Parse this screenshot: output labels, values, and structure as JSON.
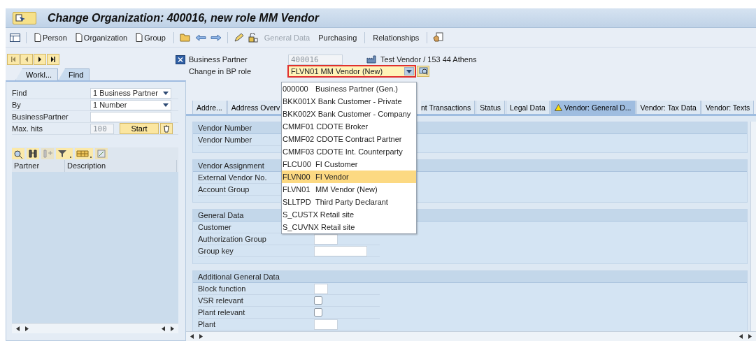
{
  "window": {
    "title": "Change Organization: 400016, new role MM Vendor"
  },
  "toolbar": {
    "create": [
      "Person",
      "Organization",
      "Group"
    ],
    "actions": [
      {
        "label": "General Data",
        "disabled": true
      },
      {
        "label": "Purchasing",
        "disabled": false
      },
      {
        "label": "Relationships",
        "disabled": false
      }
    ]
  },
  "locator": {
    "tabs": [
      {
        "label": "Workl...",
        "selected": false
      },
      {
        "label": "Find",
        "selected": true
      }
    ],
    "find": [
      {
        "label": "Find",
        "kind": "select",
        "value": "1 Business Partner"
      },
      {
        "label": "By",
        "kind": "select",
        "value": "1 Number"
      },
      {
        "label": "BusinessPartner",
        "kind": "input"
      }
    ],
    "max_hits": {
      "label": "Max. hits",
      "value": "100"
    },
    "start_button": "Start",
    "columns": [
      "Partner",
      "Description"
    ]
  },
  "header": {
    "business_partner": {
      "label": "Business Partner",
      "value": "400016",
      "description": "Test Vendor / 153 44 Athens"
    },
    "role": {
      "label": "Change in BP role",
      "value": "FLVN01 MM Vendor (New)",
      "expanded": true,
      "options": [
        {
          "code": "000000",
          "text": "Business Partner (Gen.)",
          "selected": false
        },
        {
          "code": "BKK001X",
          "text": "Bank Customer - Private",
          "selected": false
        },
        {
          "code": "BKK002X",
          "text": "Bank Customer - Company",
          "selected": false
        },
        {
          "code": "CMMF01",
          "text": "CDOTE Broker",
          "selected": false
        },
        {
          "code": "CMMF02",
          "text": "CDOTE Contract Partner",
          "selected": false
        },
        {
          "code": "CMMF03",
          "text": "CDOTE Int. Counterparty",
          "selected": false
        },
        {
          "code": "FLCU00",
          "text": "FI Customer",
          "selected": false
        },
        {
          "code": "FLVN00",
          "text": "FI Vendor",
          "selected": true
        },
        {
          "code": "FLVN01",
          "text": "MM Vendor (New)",
          "selected": false
        },
        {
          "code": "SLLTPD",
          "text": "Third Party Declarant",
          "selected": false
        },
        {
          "code": "S_CUSTX",
          "text": "Retail site",
          "selected": false
        },
        {
          "code": "S_CUVNX",
          "text": "Retail site",
          "selected": false
        }
      ]
    }
  },
  "tabs": [
    {
      "label": "Addre...",
      "selected": false,
      "warning": false,
      "kind": "normal"
    },
    {
      "label": "Address Overv",
      "selected": false,
      "warning": false,
      "kind": "cut_right"
    },
    {
      "label": "nt Transactions",
      "selected": false,
      "warning": false,
      "kind": "cut_left"
    },
    {
      "label": "Status",
      "selected": false,
      "warning": false,
      "kind": "normal"
    },
    {
      "label": "Legal Data",
      "selected": false,
      "warning": false,
      "kind": "normal"
    },
    {
      "label": "Vendor: General D...",
      "selected": true,
      "warning": true,
      "kind": "normal"
    },
    {
      "label": "Vendor: Tax Data",
      "selected": false,
      "warning": false,
      "kind": "normal"
    },
    {
      "label": "Vendor: Texts",
      "selected": false,
      "warning": false,
      "kind": "normal"
    }
  ],
  "groups": [
    {
      "title": "Vendor Number",
      "fields": [
        {
          "label": "Vendor Number",
          "kind": "plain"
        }
      ]
    },
    {
      "title": "Vendor Assignment",
      "fields": [
        {
          "label": "External Vendor No.",
          "kind": "plain"
        },
        {
          "label": "Account Group",
          "kind": "plain"
        }
      ]
    },
    {
      "title": "General Data",
      "fields": [
        {
          "label": "Customer",
          "kind": "plain"
        },
        {
          "label": "Authorization Group",
          "kind": "short_input"
        },
        {
          "label": "Group key",
          "kind": "long_input"
        }
      ]
    },
    {
      "title": "Additional General Data",
      "fields": [
        {
          "label": "Block function",
          "kind": "tiny_input"
        },
        {
          "label": "VSR relevant",
          "kind": "checkbox",
          "checked": false
        },
        {
          "label": "Plant relevant",
          "kind": "checkbox",
          "checked": false
        },
        {
          "label": "Plant",
          "kind": "short_input"
        }
      ]
    }
  ]
}
